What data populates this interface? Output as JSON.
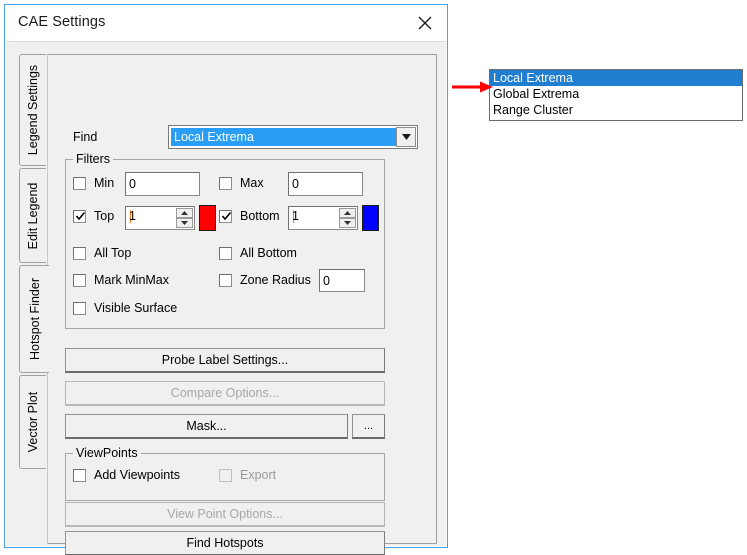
{
  "window": {
    "title": "CAE Settings",
    "close_icon": "close-icon",
    "border_color": "#4a9fe8"
  },
  "tabs": [
    {
      "label": "Legend Settings",
      "selected": false
    },
    {
      "label": "Edit Legend",
      "selected": false
    },
    {
      "label": "Hotspot Finder",
      "selected": true
    },
    {
      "label": "Vector Plot",
      "selected": false
    }
  ],
  "find": {
    "label": "Find",
    "value": "Local Extrema",
    "dropdown_icon": "chevron-down-icon",
    "options": [
      "Local Extrema",
      "Global Extrema",
      "Range Cluster"
    ],
    "selected_option": "Local Extrema",
    "highlight_color": "#2a9ef4"
  },
  "filters": {
    "title": "Filters",
    "min": {
      "label": "Min",
      "checked": false,
      "value": "0"
    },
    "max": {
      "label": "Max",
      "checked": false,
      "value": "0"
    },
    "top": {
      "label": "Top",
      "checked": true,
      "value": "1",
      "color": "#ff0000"
    },
    "bottom": {
      "label": "Bottom",
      "checked": true,
      "value": "1",
      "color": "#0000ff"
    },
    "all_top": {
      "label": "All Top",
      "checked": false
    },
    "all_bottom": {
      "label": "All Bottom",
      "checked": false
    },
    "mark_minmax": {
      "label": "Mark MinMax",
      "checked": false
    },
    "zone_radius": {
      "label": "Zone Radius",
      "checked": false,
      "value": "0"
    },
    "visible_surface": {
      "label": "Visible Surface",
      "checked": false
    }
  },
  "buttons": {
    "probe_label_settings": {
      "label": "Probe Label Settings...",
      "enabled": true
    },
    "compare_options": {
      "label": "Compare Options...",
      "enabled": false
    },
    "mask": {
      "label": "Mask...",
      "enabled": true
    },
    "mask_ellipsis": {
      "label": "...",
      "enabled": true
    },
    "view_point_options": {
      "label": "View Point Options...",
      "enabled": false
    },
    "find_hotspots": {
      "label": "Find Hotspots",
      "enabled": true
    }
  },
  "viewpoints": {
    "title": "ViewPoints",
    "add_viewpoints": {
      "label": "Add Viewpoints",
      "checked": false,
      "enabled": true
    },
    "export": {
      "label": "Export",
      "checked": false,
      "enabled": false
    }
  },
  "annotation": {
    "arrow_color": "#ff0000"
  }
}
